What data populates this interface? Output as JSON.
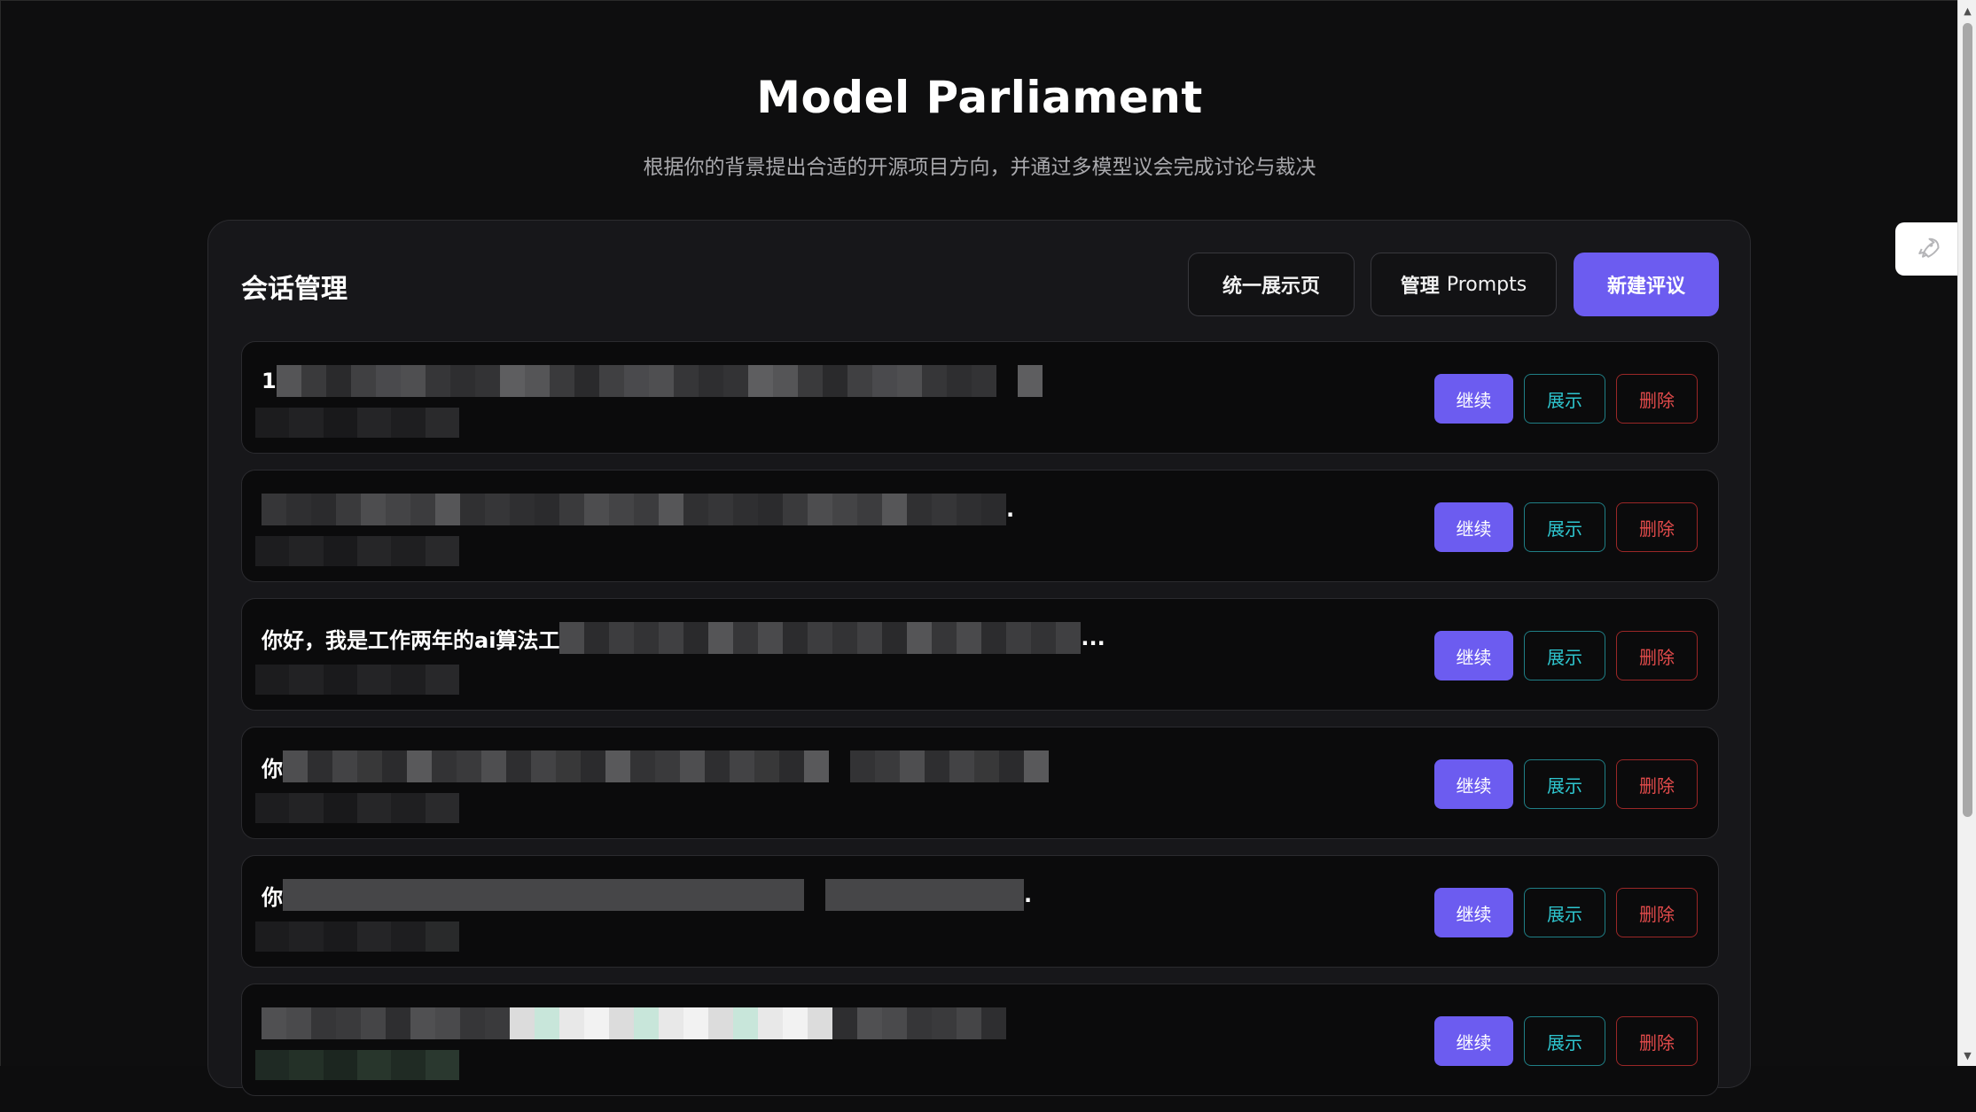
{
  "header": {
    "title": "Model Parliament",
    "subtitle": "根据你的背景提出合适的开源项目方向，并通过多模型议会完成讨论与裁决"
  },
  "panel": {
    "title": "会话管理",
    "unified_label": "统一展示页",
    "prompts_label_a": "管理",
    "prompts_label_b": "Prompts",
    "new_label": "新建评议"
  },
  "row_buttons": {
    "continue_label": "继续",
    "show_label": "展示",
    "delete_label": "删除"
  },
  "sessions": [
    {
      "title_visible": "1",
      "tail": ""
    },
    {
      "title_visible": "",
      "tail": "."
    },
    {
      "title_visible": "你好，我是工作两年的ai算法工",
      "tail": "..."
    },
    {
      "title_visible": "你",
      "tail": ""
    },
    {
      "title_visible": "你",
      "tail": "."
    },
    {
      "title_visible": "",
      "tail": ""
    }
  ],
  "colors": {
    "accent": "#6c5cf0",
    "show": "#2ec6cf",
    "delete": "#e34b4b",
    "background": "#0e0e0f",
    "panel": "#17171a"
  },
  "icons": {
    "float_button": "rocket-icon"
  }
}
